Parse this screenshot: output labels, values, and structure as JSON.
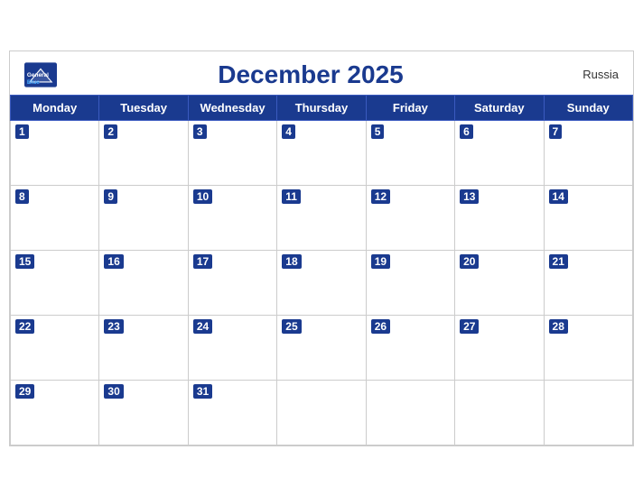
{
  "header": {
    "title": "December 2025",
    "country": "Russia",
    "logo_line1": "General",
    "logo_line2": "Blue"
  },
  "weekdays": [
    "Monday",
    "Tuesday",
    "Wednesday",
    "Thursday",
    "Friday",
    "Saturday",
    "Sunday"
  ],
  "weeks": [
    [
      1,
      2,
      3,
      4,
      5,
      6,
      7
    ],
    [
      8,
      9,
      10,
      11,
      12,
      13,
      14
    ],
    [
      15,
      16,
      17,
      18,
      19,
      20,
      21
    ],
    [
      22,
      23,
      24,
      25,
      26,
      27,
      28
    ],
    [
      29,
      30,
      31,
      null,
      null,
      null,
      null
    ]
  ]
}
